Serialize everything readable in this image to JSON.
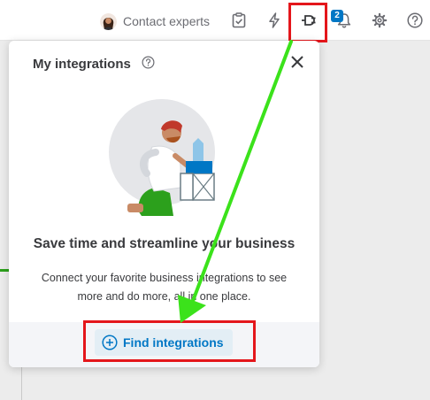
{
  "topbar": {
    "expert_label": "Contact experts",
    "notification_count": "2",
    "icons": [
      "checklist-icon",
      "lightning-icon",
      "plug-icon",
      "bell-icon",
      "gear-icon",
      "help-icon"
    ]
  },
  "panel": {
    "title": "My integrations",
    "headline": "Save time and streamline your business",
    "description": "Connect your favorite business integrations to see more and do more, all in one place.",
    "button_label": "Find integrations"
  },
  "annotations": {
    "highlight_color": "#e4161b",
    "arrow_color": "#3be21b"
  },
  "colors": {
    "accent": "#0077c5",
    "brand_green": "#2ca01c"
  }
}
